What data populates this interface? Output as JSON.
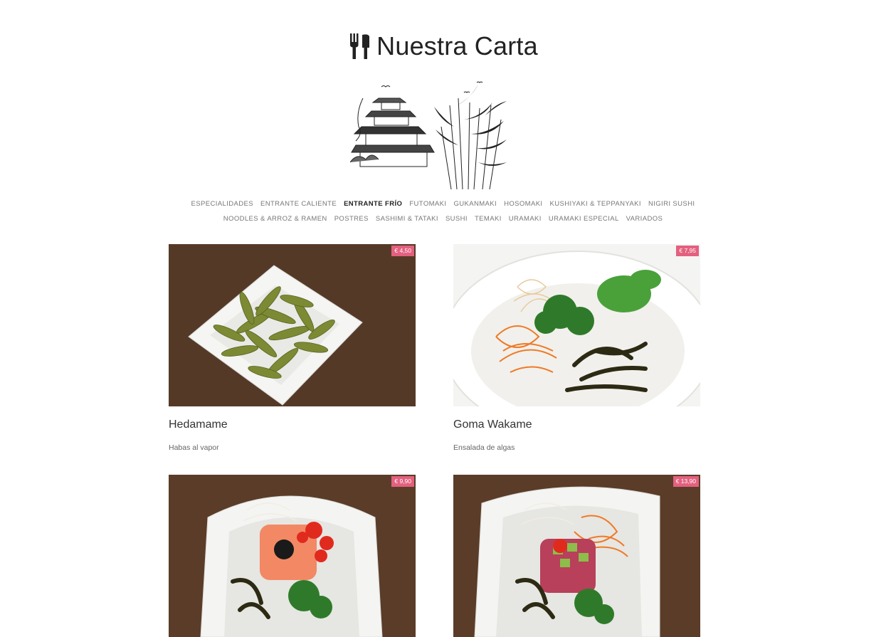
{
  "page": {
    "title": "Nuestra Carta",
    "title_icon": "cutlery-icon",
    "illustration": "japanese-castle-bamboo-illustration"
  },
  "colors": {
    "price_badge": "#e4607f",
    "text_dark": "#222222",
    "text_muted": "#777777"
  },
  "nav": {
    "row1": [
      {
        "label": "ESPECIALIDADES",
        "active": false
      },
      {
        "label": "ENTRANTE CALIENTE",
        "active": false
      },
      {
        "label": "ENTRANTE FRÍO",
        "active": true
      },
      {
        "label": "FUTOMAKI",
        "active": false
      },
      {
        "label": "GUKANMAKI",
        "active": false
      },
      {
        "label": "HOSOMAKI",
        "active": false
      },
      {
        "label": "KUSHIYAKI & TEPPANYAKI",
        "active": false
      },
      {
        "label": "NIGIRI SUSHI",
        "active": false
      }
    ],
    "row2": [
      {
        "label": "NOODLES & ARROZ & RAMEN",
        "active": false
      },
      {
        "label": "POSTRES",
        "active": false
      },
      {
        "label": "SASHIMI & TATAKI",
        "active": false
      },
      {
        "label": "SUSHI",
        "active": false
      },
      {
        "label": "TEMAKI",
        "active": false
      },
      {
        "label": "URAMAKI",
        "active": false
      },
      {
        "label": "URAMAKI ESPECIAL",
        "active": false
      },
      {
        "label": "VARIADOS",
        "active": false
      }
    ]
  },
  "dishes": [
    {
      "name": "Hedamame",
      "description": "Habas al vapor",
      "price": "€ 4,50",
      "photo": "edamame-photo"
    },
    {
      "name": "Goma Wakame",
      "description": "Ensalada de algas",
      "price": "€ 7,95",
      "photo": "seaweed-salad-photo"
    },
    {
      "name": "",
      "description": "",
      "price": "€ 9,90",
      "photo": "salmon-tartar-photo"
    },
    {
      "name": "",
      "description": "",
      "price": "€ 13,90",
      "photo": "tuna-tartar-photo"
    }
  ]
}
